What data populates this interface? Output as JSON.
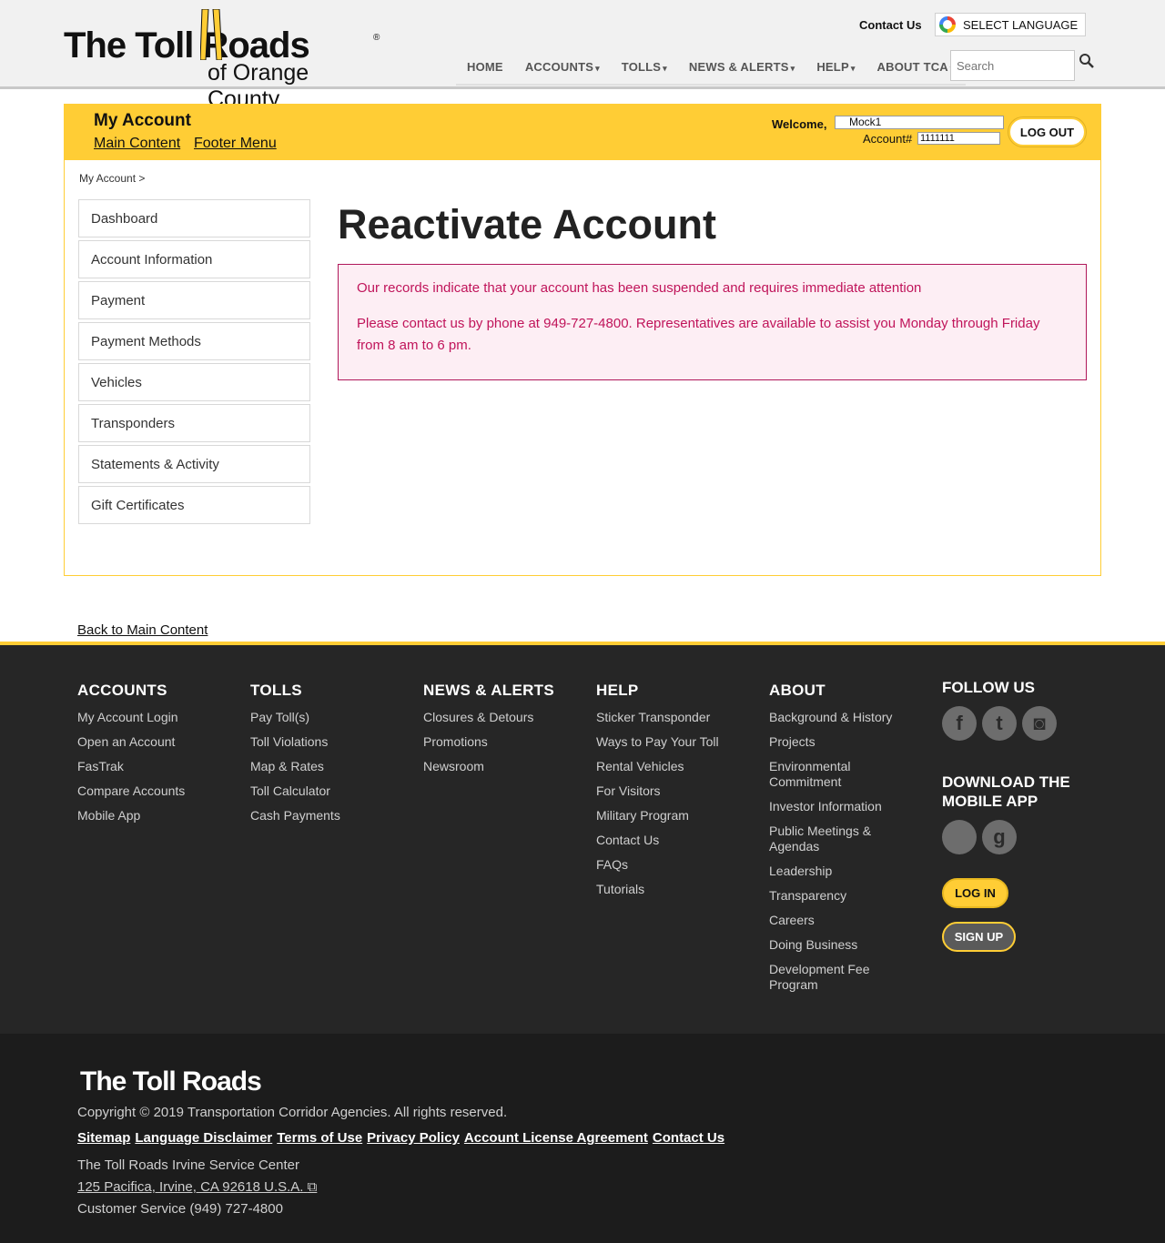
{
  "header": {
    "logo_brand": "The Toll Roads",
    "logo_sub": "of Orange County",
    "contact_us": "Contact Us",
    "language": "SELECT LANGUAGE",
    "nav": [
      {
        "label": "HOME",
        "caret": ""
      },
      {
        "label": "ACCOUNTS",
        "caret": "▾"
      },
      {
        "label": "TOLLS",
        "caret": "▾"
      },
      {
        "label": "NEWS & ALERTS",
        "caret": "▾"
      },
      {
        "label": "HELP",
        "caret": "▾"
      },
      {
        "label": "ABOUT TCA",
        "caret": "▾"
      }
    ],
    "search_placeholder": "Search"
  },
  "account_bar": {
    "title": "My Account",
    "skip_main": "Main Content",
    "skip_footer": "Footer Menu",
    "welcome_label": "Welcome,",
    "welcome_name": "Mock1",
    "account_label": "Account#",
    "account_number": "1111111",
    "logout": "LOG OUT"
  },
  "breadcrumb": "My Account  >",
  "sidebar": {
    "items": [
      {
        "label": "Dashboard"
      },
      {
        "label": "Account Information"
      },
      {
        "label": "Payment"
      },
      {
        "label": "Payment Methods"
      },
      {
        "label": "Vehicles"
      },
      {
        "label": "Transponders"
      },
      {
        "label": "Statements & Activity"
      },
      {
        "label": "Gift Certificates"
      }
    ]
  },
  "main": {
    "title": "Reactivate Account",
    "alert_line1": "Our records indicate that your account has been suspended and requires immediate attention",
    "alert_line2": "Please contact us by phone at 949-727-4800. Representatives are available to assist you Monday through Friday from 8 am to 6 pm."
  },
  "back_link": "Back to Main Content",
  "footer": {
    "columns": [
      {
        "title": "ACCOUNTS",
        "links": [
          "My Account Login",
          "Open an Account",
          "FasTrak",
          "Compare Accounts",
          "Mobile App"
        ]
      },
      {
        "title": "TOLLS",
        "links": [
          "Pay Toll(s)",
          "Toll Violations",
          "Map & Rates",
          "Toll Calculator",
          "Cash Payments"
        ]
      },
      {
        "title": "NEWS & ALERTS",
        "links": [
          "Closures & Detours",
          "Promotions",
          "Newsroom"
        ]
      },
      {
        "title": "HELP",
        "links": [
          "Sticker Transponder",
          "Ways to Pay Your Toll",
          "Rental Vehicles",
          "For Visitors",
          "Military Program",
          "Contact Us",
          "FAQs",
          "Tutorials"
        ]
      },
      {
        "title": "ABOUT",
        "links": [
          "Background & History",
          "Projects",
          "Environmental Commitment",
          "Investor Information",
          "Public Meetings & Agendas",
          "Leadership",
          "Transparency",
          "Careers",
          "Doing Business",
          "Development Fee Program"
        ]
      }
    ],
    "follow_title": "FOLLOW US",
    "download_title": "DOWNLOAD THE MOBILE APP",
    "login": "LOG IN",
    "signup": "SIGN UP",
    "social_icons": [
      "facebook-icon",
      "twitter-icon",
      "instagram-icon"
    ],
    "app_icons": [
      "apple-icon",
      "google-play-icon"
    ]
  },
  "bottom": {
    "logo_brand": "The Toll Roads",
    "copyright": "Copyright © 2019 Transportation Corridor Agencies. All rights reserved.",
    "links": [
      "Sitemap",
      "Language Disclaimer",
      "Terms of Use",
      "Privacy Policy",
      "Account License Agreement",
      "Contact Us"
    ],
    "service_center": "The Toll Roads Irvine Service Center",
    "address": "125 Pacifica, Irvine, CA 92618 U.S.A.",
    "customer_service": "Customer Service (949) 727-4800"
  },
  "colors": {
    "accent": "#ffcd35",
    "alert_text": "#c0145a",
    "alert_bg": "#fdeef4",
    "footer_bg": "#262626"
  }
}
